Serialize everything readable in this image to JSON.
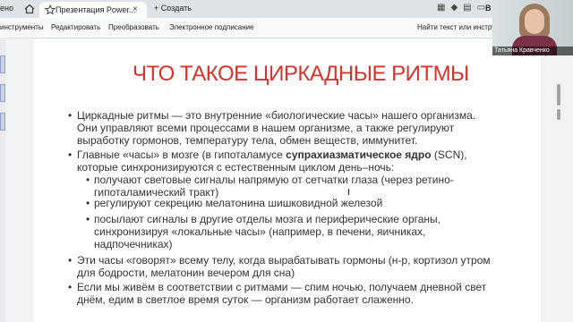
{
  "browser": {
    "prev_tab_label": "ено",
    "tab_title": "Презентация Power...",
    "tab_close": "×",
    "new_tab_label": "+ Создать",
    "bookmark_label": "В"
  },
  "toolbar": {
    "items": [
      "инструменты",
      "Редактировать",
      "Преобразовать",
      "Электронное подписание",
      "Найти текст или инстру"
    ]
  },
  "slide": {
    "title": "ЧТО ТАКОЕ ЦИРКАДНЫЕ РИТМЫ",
    "bullet_symbol": "•",
    "p1": [
      "Циркадные ритмы — это внутренние «биологические часы» нашего организма.",
      "Они управляют всеми процессами в нашем организме, а также регулируют",
      "выработку гормонов, температуру тела, обмен веществ, иммунитет."
    ],
    "p2_prefix": "Главные «часы» в мозге (в гипоталамусе ",
    "p2_bold": "супрахиазматическое ядро",
    "p2_suffix": " (SCN),",
    "p2_line2": "которые синхронизируются с естественным циклом день–ночь:",
    "sub1": [
      "получают световые сигналы напрямую от сетчатки глаза (через ретино-",
      "гипоталамический тракт)"
    ],
    "sub2": [
      "регулируют секрецию мелатонина шишковидной железой"
    ],
    "sub3": [
      "посылают сигналы в другие отделы мозга и периферические органы,",
      "синхронизируя «локальные часы» (например, в печени, яичниках,",
      "надпочечниках)"
    ],
    "p3": [
      "Эти часы «говорят» всему телу, когда вырабатывать гормоны (н-р, кортизол утром",
      "для бодрости, мелатонин вечером для сна)"
    ],
    "p4": [
      "Если мы живём в соответствии с ритмами — спим ночью, получаем дневной свет",
      "днём, едим в светлое время суток — организм работает слаженно."
    ]
  },
  "webcam": {
    "name": "Татьяна Кравченко"
  },
  "colors": {
    "title_red": "#d8322a",
    "body_text": "#333333"
  }
}
